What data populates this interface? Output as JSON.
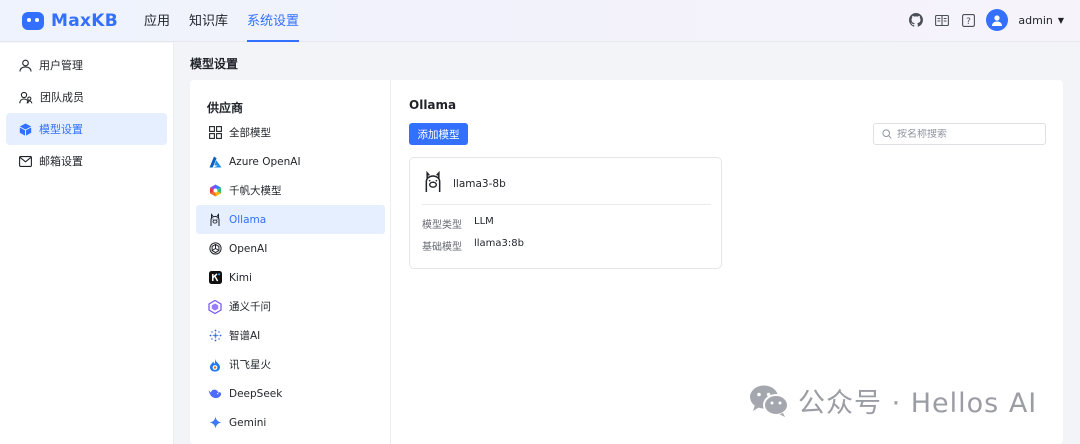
{
  "app": {
    "logo_text": "MaxKB"
  },
  "topnav": [
    {
      "label": "应用",
      "active": false
    },
    {
      "label": "知识库",
      "active": false
    },
    {
      "label": "系统设置",
      "active": true
    }
  ],
  "header": {
    "username": "admin",
    "icons": [
      "github-icon",
      "book-icon",
      "help-icon",
      "user-avatar-icon",
      "caret-down-icon"
    ]
  },
  "sidebar": {
    "items": [
      {
        "label": "用户管理",
        "icon": "user-icon",
        "active": false
      },
      {
        "label": "团队成员",
        "icon": "team-icon",
        "active": false
      },
      {
        "label": "模型设置",
        "icon": "cube-icon",
        "active": true
      },
      {
        "label": "邮箱设置",
        "icon": "mail-icon",
        "active": false
      }
    ]
  },
  "page": {
    "title": "模型设置"
  },
  "providers": {
    "heading": "供应商",
    "items": [
      {
        "label": "全部模型",
        "icon": "grid-icon",
        "active": false
      },
      {
        "label": "Azure OpenAI",
        "icon": "azure-icon",
        "active": false
      },
      {
        "label": "千帆大模型",
        "icon": "qianfan-icon",
        "active": false
      },
      {
        "label": "Ollama",
        "icon": "ollama-icon",
        "active": true
      },
      {
        "label": "OpenAI",
        "icon": "openai-icon",
        "active": false
      },
      {
        "label": "Kimi",
        "icon": "kimi-icon",
        "active": false
      },
      {
        "label": "通义千问",
        "icon": "tongyi-icon",
        "active": false
      },
      {
        "label": "智谱AI",
        "icon": "zhipu-icon",
        "active": false
      },
      {
        "label": "讯飞星火",
        "icon": "xunfei-icon",
        "active": false
      },
      {
        "label": "DeepSeek",
        "icon": "deepseek-icon",
        "active": false
      },
      {
        "label": "Gemini",
        "icon": "gemini-icon",
        "active": false
      }
    ]
  },
  "content": {
    "provider_title": "Ollama",
    "add_button": "添加模型",
    "search_placeholder": "按名称搜索",
    "models": [
      {
        "name": "llama3-8b",
        "icon": "ollama-icon",
        "fields": [
          {
            "key": "模型类型",
            "value": "LLM"
          },
          {
            "key": "基础模型",
            "value": "llama3:8b"
          }
        ]
      }
    ]
  },
  "watermark": {
    "text": "公众号 · Hellos AI",
    "icon": "wechat-icon"
  },
  "colors": {
    "accent": "#3370ff",
    "active_bg": "#e6efff",
    "page_bg": "#f3f4f7"
  }
}
